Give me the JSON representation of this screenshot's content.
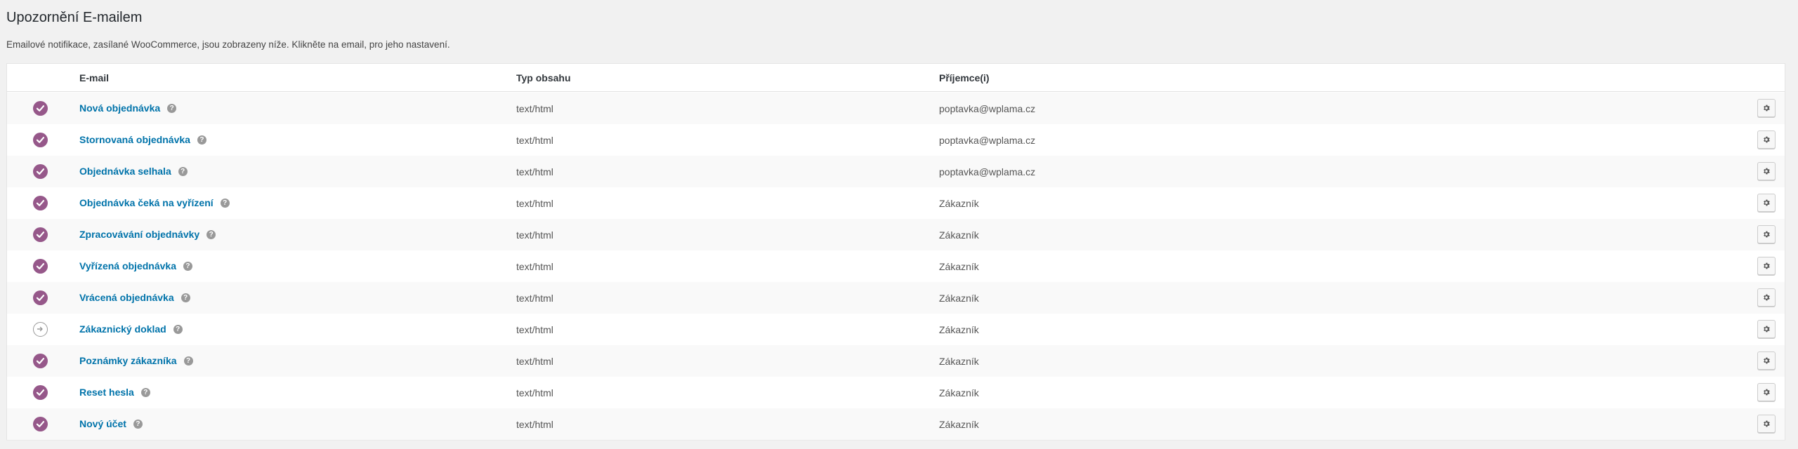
{
  "page": {
    "title": "Upozornění E-mailem",
    "description": "Emailové notifikace, zasílané WooCommerce, jsou zobrazeny níže. Klikněte na email, pro jeho nastavení."
  },
  "table": {
    "headers": {
      "email": "E-mail",
      "content_type": "Typ obsahu",
      "recipients": "Příjemce(i)"
    },
    "rows": [
      {
        "name": "Nová objednávka",
        "content_type": "text/html",
        "recipient": "poptavka@wplama.cz",
        "status": "enabled"
      },
      {
        "name": "Stornovaná objednávka",
        "content_type": "text/html",
        "recipient": "poptavka@wplama.cz",
        "status": "enabled"
      },
      {
        "name": "Objednávka selhala",
        "content_type": "text/html",
        "recipient": "poptavka@wplama.cz",
        "status": "enabled"
      },
      {
        "name": "Objednávka čeká na vyřízení",
        "content_type": "text/html",
        "recipient": "Zákazník",
        "status": "enabled"
      },
      {
        "name": "Zpracovávání objednávky",
        "content_type": "text/html",
        "recipient": "Zákazník",
        "status": "enabled"
      },
      {
        "name": "Vyřízená objednávka",
        "content_type": "text/html",
        "recipient": "Zákazník",
        "status": "enabled"
      },
      {
        "name": "Vrácená objednávka",
        "content_type": "text/html",
        "recipient": "Zákazník",
        "status": "enabled"
      },
      {
        "name": "Zákaznický doklad",
        "content_type": "text/html",
        "recipient": "Zákazník",
        "status": "manual"
      },
      {
        "name": "Poznámky zákazníka",
        "content_type": "text/html",
        "recipient": "Zákazník",
        "status": "enabled"
      },
      {
        "name": "Reset hesla",
        "content_type": "text/html",
        "recipient": "Zákazník",
        "status": "enabled"
      },
      {
        "name": "Nový účet",
        "content_type": "text/html",
        "recipient": "Zákazník",
        "status": "enabled"
      }
    ],
    "help_glyph": "?",
    "icons": {
      "enabled": "check-circle-icon",
      "manual": "manual-arrow-icon",
      "manage": "gear-icon",
      "help": "help-icon"
    }
  },
  "colors": {
    "accent": "#96588a",
    "link": "#0073aa",
    "background": "#f1f1f1"
  }
}
